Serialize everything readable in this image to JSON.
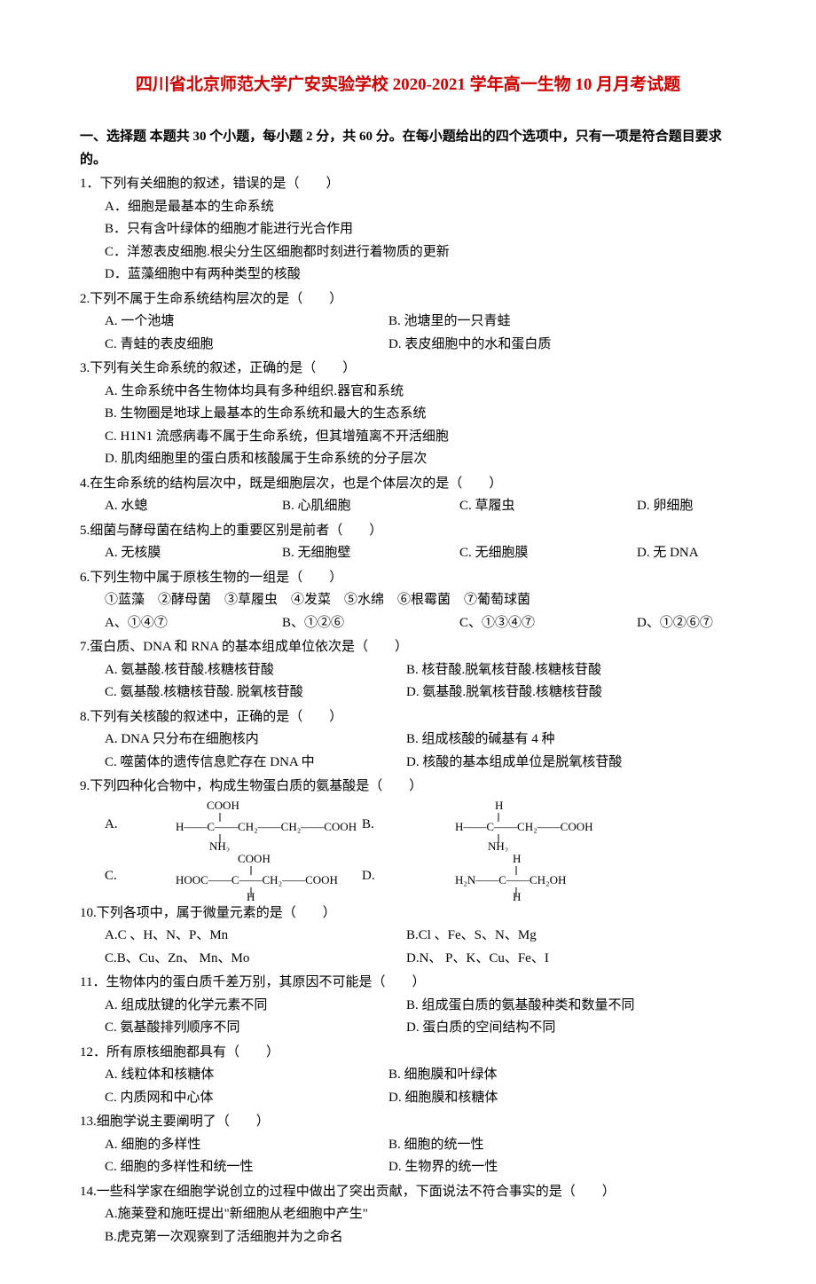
{
  "title": "四川省北京师范大学广安实验学校 2020-2021 学年高一生物 10 月月考试题",
  "sectionHeader": "一、选择题 本题共 30 个小题，每小题 2 分，共 60 分。在每小题给出的四个选项中，只有一项是符合题目要求的。",
  "q1": {
    "stem": "1．下列有关细胞的叙述，错误的是（　　）",
    "a": "A．细胞是最基本的生命系统",
    "b": "B．只有含叶绿体的细胞才能进行光合作用",
    "c": "C．洋葱表皮细胞.根尖分生区细胞都时刻进行着物质的更新",
    "d": "D．蓝藻细胞中有两种类型的核酸"
  },
  "q2": {
    "stem": "2.下列不属于生命系统结构层次的是（　　）",
    "a": "A. 一个池塘",
    "b": "B. 池塘里的一只青蛙",
    "c": "C. 青蛙的表皮细胞",
    "d": "D. 表皮细胞中的水和蛋白质"
  },
  "q3": {
    "stem": "3.下列有关生命系统的叙述，正确的是（　　）",
    "a": "A. 生命系统中各生物体均具有多种组织.器官和系统",
    "b": "B. 生物圈是地球上最基本的生命系统和最大的生态系统",
    "c": "C. H1N1 流感病毒不属于生命系统，但其增殖离不开活细胞",
    "d": "D. 肌肉细胞里的蛋白质和核酸属于生命系统的分子层次"
  },
  "q4": {
    "stem": "4.在生命系统的结构层次中，既是细胞层次，也是个体层次的是（　　）",
    "a": "A. 水螅",
    "b": "B. 心肌细胞",
    "c": "C. 草履虫",
    "d": "D. 卵细胞"
  },
  "q5": {
    "stem": "5.细菌与酵母菌在结构上的重要区别是前者（　　）",
    "a": "A. 无核膜",
    "b": "B. 无细胞壁",
    "c": "C. 无细胞膜",
    "d": "D. 无 DNA"
  },
  "q6": {
    "stem": "6.下列生物中属于原核生物的一组是（　　）",
    "list": "①蓝藻　②酵母菌　③草履虫　④发菜　⑤水绵　⑥根霉菌　⑦葡萄球菌",
    "a": "A、①④⑦",
    "b": "B、①②⑥",
    "c": "C、①③④⑦",
    "d": "D、①②⑥⑦"
  },
  "q7": {
    "stem": "7.蛋白质、DNA 和 RNA 的基本组成单位依次是（　　）",
    "a": "A. 氨基酸.核苷酸.核糖核苷酸",
    "b": "B. 核苷酸.脱氧核苷酸.核糖核苷酸",
    "c": "C. 氨基酸.核糖核苷酸. 脱氧核苷酸",
    "d": "D. 氨基酸.脱氧核苷酸.核糖核苷酸"
  },
  "q8": {
    "stem": "8.下列有关核酸的叙述中，正确的是（　　）",
    "a": "A. DNA 只分布在细胞核内",
    "b": "B. 组成核酸的碱基有 4 种",
    "c": "C. 噬菌体的遗传信息贮存在 DNA 中",
    "d": "D. 核酸的基本组成单位是脱氧核苷酸"
  },
  "q9": {
    "stem": "9.下列四种化合物中，构成生物蛋白质的氨基酸是（　　）",
    "labelA": "A.",
    "labelB": "B.",
    "labelC": "C.",
    "labelD": "D."
  },
  "q10": {
    "stem": "10.下列各项中，属于微量元素的是（　　）",
    "a": "A.C 、H、N、P、Mn",
    "b": "B.Cl 、Fe、S、N、Mg",
    "c": "C.B、Cu、Zn、 Mn、Mo",
    "d": "D.N、 P、K、Cu、Fe、I"
  },
  "q11": {
    "stem": "11．生物体内的蛋白质千差万别，其原因不可能是（　　）",
    "a": "A. 组成肽键的化学元素不同",
    "b": "B. 组成蛋白质的氨基酸种类和数量不同",
    "c": "C. 氨基酸排列顺序不同",
    "d": "D. 蛋白质的空间结构不同"
  },
  "q12": {
    "stem": "12．所有原核细胞都具有（　　）",
    "a": "A. 线粒体和核糖体",
    "b": "B. 细胞膜和叶绿体",
    "c": "C. 内质网和中心体",
    "d": "D. 细胞膜和核糖体"
  },
  "q13": {
    "stem": "13.细胞学说主要阐明了（　　）",
    "a": "A. 细胞的多样性",
    "b": "B. 细胞的统一性",
    "c": "C. 细胞的多样性和统一性",
    "d": "D. 生物界的统一性"
  },
  "q14": {
    "stem": "14.一些科学家在细胞学说创立的过程中做出了突出贡献，下面说法不符合事实的是（　　）",
    "a": "A.施莱登和施旺提出\"新细胞从老细胞中产生\"",
    "b": "B.虎克第一次观察到了活细胞并为之命名"
  }
}
